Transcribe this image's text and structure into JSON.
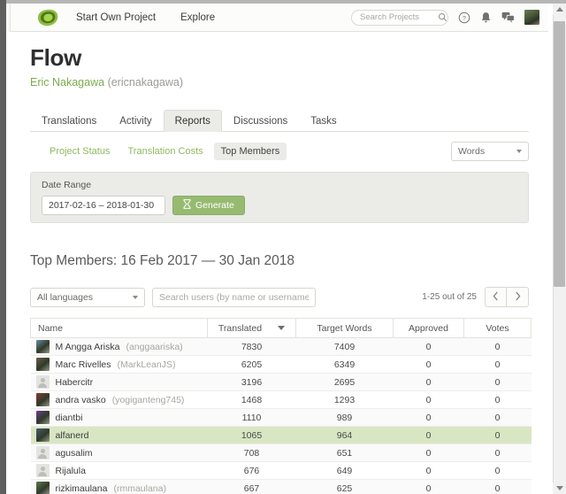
{
  "topbar": {
    "logo_icon": "leaf-logo-icon",
    "links": [
      {
        "label": "Start Own Project"
      },
      {
        "label": "Explore"
      }
    ],
    "search": {
      "placeholder": "Search Projects",
      "value": "",
      "icon": "search-icon"
    },
    "icons": [
      {
        "name": "help-circle-icon"
      },
      {
        "name": "bell-icon"
      },
      {
        "name": "chat-bubbles-icon"
      }
    ],
    "avatar": {
      "name": "user-avatar"
    }
  },
  "project": {
    "title": "Flow",
    "owner_name": "Eric Nakagawa",
    "owner_handle": "(ericnakagawa)"
  },
  "tabs": [
    {
      "label": "Translations",
      "active": false
    },
    {
      "label": "Activity",
      "active": false
    },
    {
      "label": "Reports",
      "active": true
    },
    {
      "label": "Discussions",
      "active": false
    },
    {
      "label": "Tasks",
      "active": false
    }
  ],
  "subtabs": [
    {
      "label": "Project Status",
      "active": false
    },
    {
      "label": "Translation Costs",
      "active": false
    },
    {
      "label": "Top Members",
      "active": true
    }
  ],
  "unit_select": {
    "value": "Words",
    "icon": "chevron-down-icon"
  },
  "date_panel": {
    "label": "Date Range",
    "value": "2017-02-16 – 2018-01-30",
    "generate_label": "Generate",
    "generate_icon": "hourglass-icon",
    "accent": "#97ba71"
  },
  "report_heading": "Top Members: 16 Feb 2017 — 30 Jan 2018",
  "filters": {
    "language_select": {
      "value": "All languages",
      "icon": "chevron-down-icon"
    },
    "user_search": {
      "placeholder": "Search users (by name or username)",
      "value": ""
    },
    "pager_count": "1-25 out of 25",
    "prev_icon": "chevron-left-icon",
    "next_icon": "chevron-right-icon"
  },
  "table": {
    "columns": [
      "Name",
      "Translated",
      "Target Words",
      "Approved",
      "Votes"
    ],
    "sorted_column": "Translated",
    "sort_icon": "sort-descending-icon",
    "highlight_color": "#d9e6c3",
    "rows": [
      {
        "full_name": "M Angga Ariska",
        "handle": "(anggaariska)",
        "translated": "7830",
        "target_words": "7409",
        "approved": "0",
        "votes": "0",
        "avatar": "photo",
        "avatar_color": "#6e8fa8",
        "highlighted": false
      },
      {
        "full_name": "Marc Rivelles",
        "handle": "(MarkLeanJS)",
        "translated": "6205",
        "target_words": "6349",
        "approved": "0",
        "votes": "0",
        "avatar": "photo",
        "avatar_color": "#6b5c4d",
        "highlighted": false
      },
      {
        "full_name": "Habercitr",
        "handle": "",
        "translated": "3196",
        "target_words": "2695",
        "approved": "0",
        "votes": "0",
        "avatar": "placeholder",
        "avatar_color": "",
        "highlighted": false
      },
      {
        "full_name": "andra vasko",
        "handle": "(yogiganteng745)",
        "translated": "1468",
        "target_words": "1293",
        "approved": "0",
        "votes": "0",
        "avatar": "photo",
        "avatar_color": "#8a3a32",
        "highlighted": false
      },
      {
        "full_name": "diantbi",
        "handle": "",
        "translated": "1110",
        "target_words": "989",
        "approved": "0",
        "votes": "0",
        "avatar": "photo",
        "avatar_color": "#6c3c8f",
        "highlighted": false
      },
      {
        "full_name": "alfanerd",
        "handle": "",
        "translated": "1065",
        "target_words": "964",
        "approved": "0",
        "votes": "0",
        "avatar": "photo",
        "avatar_color": "#4a5c6e",
        "highlighted": true
      },
      {
        "full_name": "agusalim",
        "handle": "",
        "translated": "708",
        "target_words": "651",
        "approved": "0",
        "votes": "0",
        "avatar": "placeholder",
        "avatar_color": "",
        "highlighted": false
      },
      {
        "full_name": "Rijalula",
        "handle": "",
        "translated": "676",
        "target_words": "649",
        "approved": "0",
        "votes": "0",
        "avatar": "placeholder",
        "avatar_color": "",
        "highlighted": false
      },
      {
        "full_name": "rizkimaulana",
        "handle": "(rmmaulana)",
        "translated": "667",
        "target_words": "625",
        "approved": "0",
        "votes": "0",
        "avatar": "photo",
        "avatar_color": "#5f7a4a",
        "highlighted": false
      }
    ]
  }
}
